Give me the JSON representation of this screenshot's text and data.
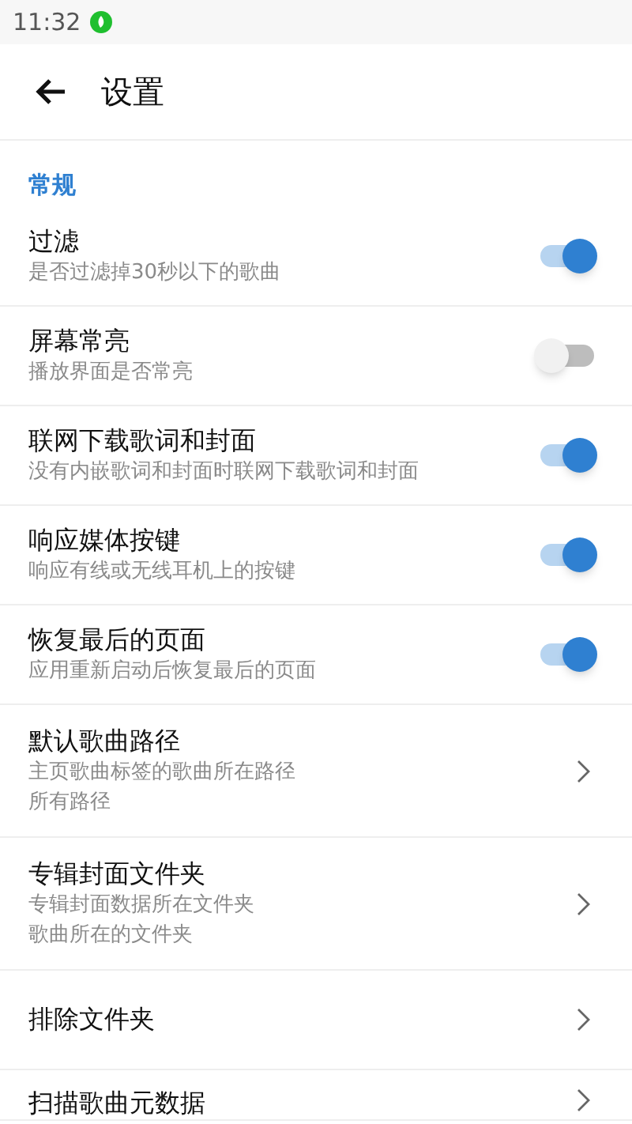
{
  "status_bar": {
    "time": "11:32"
  },
  "header": {
    "title": "设置"
  },
  "section": {
    "title": "常规"
  },
  "items": [
    {
      "kind": "switch",
      "title": "过滤",
      "subtitles": [
        "是否过滤掉30秒以下的歌曲"
      ],
      "on": true
    },
    {
      "kind": "switch",
      "title": "屏幕常亮",
      "subtitles": [
        "播放界面是否常亮"
      ],
      "on": false
    },
    {
      "kind": "switch",
      "title": "联网下载歌词和封面",
      "subtitles": [
        "没有内嵌歌词和封面时联网下载歌词和封面"
      ],
      "on": true
    },
    {
      "kind": "switch",
      "title": "响应媒体按键",
      "subtitles": [
        "响应有线或无线耳机上的按键"
      ],
      "on": true
    },
    {
      "kind": "switch",
      "title": "恢复最后的页面",
      "subtitles": [
        "应用重新启动后恢复最后的页面"
      ],
      "on": true
    },
    {
      "kind": "link",
      "title": "默认歌曲路径",
      "subtitles": [
        "主页歌曲标签的歌曲所在路径",
        "所有路径"
      ]
    },
    {
      "kind": "link",
      "title": "专辑封面文件夹",
      "subtitles": [
        "专辑封面数据所在文件夹",
        "歌曲所在的文件夹"
      ]
    },
    {
      "kind": "link",
      "title": "排除文件夹"
    },
    {
      "kind": "link",
      "title": "扫描歌曲元数据"
    }
  ]
}
